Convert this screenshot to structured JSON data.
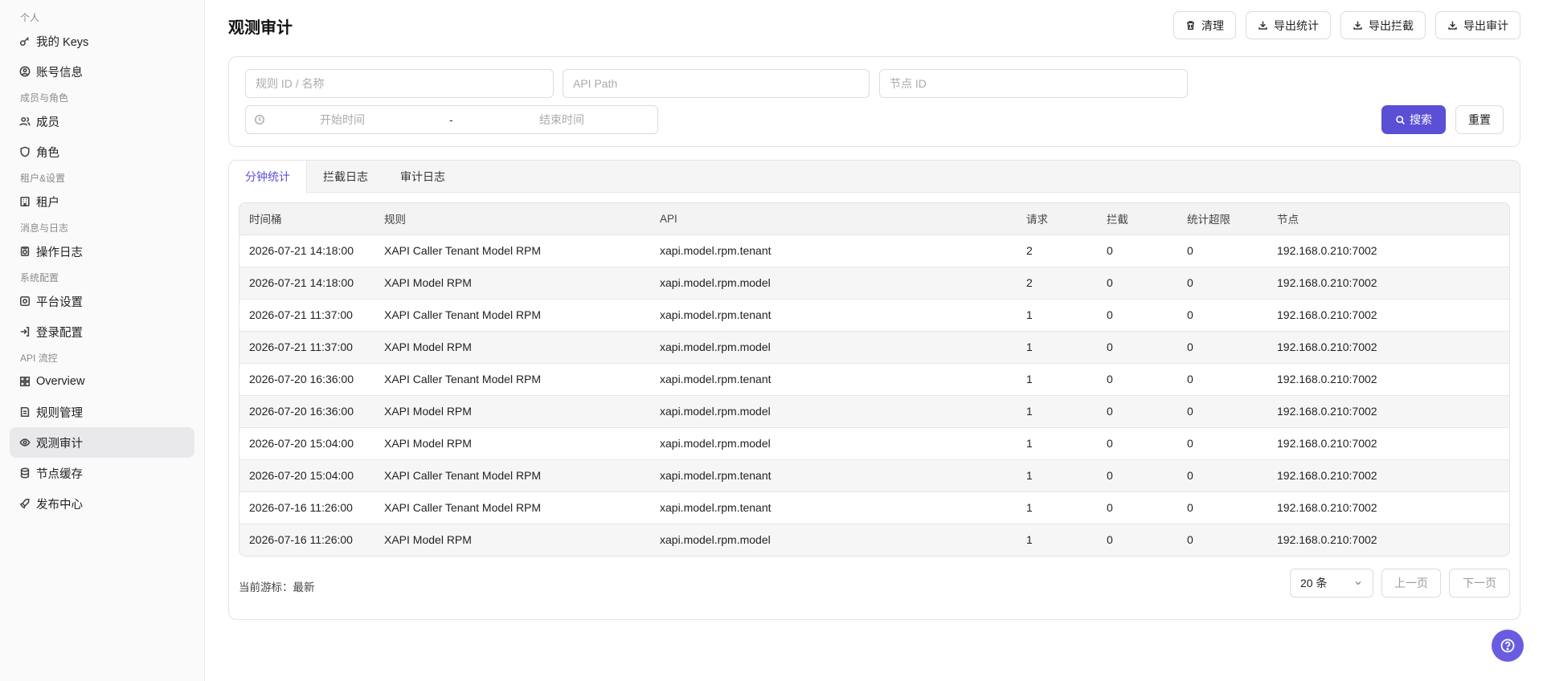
{
  "sidebar": {
    "groups": [
      {
        "label": "个人",
        "items": [
          {
            "label": "我的 Keys",
            "icon": "key-icon"
          },
          {
            "label": "账号信息",
            "icon": "user-circle-icon"
          }
        ]
      },
      {
        "label": "成员与角色",
        "items": [
          {
            "label": "成员",
            "icon": "users-icon"
          },
          {
            "label": "角色",
            "icon": "shield-icon"
          }
        ]
      },
      {
        "label": "租户&设置",
        "items": [
          {
            "label": "租户",
            "icon": "building-icon"
          }
        ]
      },
      {
        "label": "消息与日志",
        "items": [
          {
            "label": "操作日志",
            "icon": "log-icon"
          }
        ]
      },
      {
        "label": "系统配置",
        "items": [
          {
            "label": "平台设置",
            "icon": "settings-icon"
          },
          {
            "label": "登录配置",
            "icon": "login-icon"
          }
        ]
      },
      {
        "label": "API 流控",
        "items": [
          {
            "label": "Overview",
            "icon": "grid-icon"
          },
          {
            "label": "规则管理",
            "icon": "rules-icon"
          },
          {
            "label": "观测审计",
            "icon": "audit-icon"
          },
          {
            "label": "节点缓存",
            "icon": "database-icon"
          },
          {
            "label": "发布中心",
            "icon": "rocket-icon"
          }
        ]
      }
    ],
    "active": "观测审计"
  },
  "header": {
    "title": "观测审计",
    "buttons": {
      "clear": "清理",
      "export_stats": "导出统计",
      "export_block": "导出拦截",
      "export_audit": "导出审计"
    }
  },
  "filters": {
    "rule_placeholder": "规则 ID / 名称",
    "api_placeholder": "API Path",
    "node_placeholder": "节点 ID",
    "start_placeholder": "开始时间",
    "range_sep": "-",
    "end_placeholder": "结束时间",
    "search_label": "搜索",
    "reset_label": "重置"
  },
  "tabs": {
    "minute_stats": "分钟统计",
    "block_log": "拦截日志",
    "audit_log": "审计日志",
    "active": "分钟统计"
  },
  "table": {
    "columns": {
      "bucket": "时间桶",
      "rule": "规则",
      "api": "API",
      "requests": "请求",
      "blocked": "拦截",
      "over": "统计超限",
      "node": "节点"
    },
    "rows": [
      {
        "bucket": "2026-07-21 14:18:00",
        "rule": "XAPI Caller Tenant Model RPM",
        "api": "xapi.model.rpm.tenant",
        "requests": "2",
        "blocked": "0",
        "over": "0",
        "node": "192.168.0.210:7002"
      },
      {
        "bucket": "2026-07-21 14:18:00",
        "rule": "XAPI Model RPM",
        "api": "xapi.model.rpm.model",
        "requests": "2",
        "blocked": "0",
        "over": "0",
        "node": "192.168.0.210:7002"
      },
      {
        "bucket": "2026-07-21 11:37:00",
        "rule": "XAPI Caller Tenant Model RPM",
        "api": "xapi.model.rpm.tenant",
        "requests": "1",
        "blocked": "0",
        "over": "0",
        "node": "192.168.0.210:7002"
      },
      {
        "bucket": "2026-07-21 11:37:00",
        "rule": "XAPI Model RPM",
        "api": "xapi.model.rpm.model",
        "requests": "1",
        "blocked": "0",
        "over": "0",
        "node": "192.168.0.210:7002"
      },
      {
        "bucket": "2026-07-20 16:36:00",
        "rule": "XAPI Caller Tenant Model RPM",
        "api": "xapi.model.rpm.tenant",
        "requests": "1",
        "blocked": "0",
        "over": "0",
        "node": "192.168.0.210:7002"
      },
      {
        "bucket": "2026-07-20 16:36:00",
        "rule": "XAPI Model RPM",
        "api": "xapi.model.rpm.model",
        "requests": "1",
        "blocked": "0",
        "over": "0",
        "node": "192.168.0.210:7002"
      },
      {
        "bucket": "2026-07-20 15:04:00",
        "rule": "XAPI Model RPM",
        "api": "xapi.model.rpm.model",
        "requests": "1",
        "blocked": "0",
        "over": "0",
        "node": "192.168.0.210:7002"
      },
      {
        "bucket": "2026-07-20 15:04:00",
        "rule": "XAPI Caller Tenant Model RPM",
        "api": "xapi.model.rpm.tenant",
        "requests": "1",
        "blocked": "0",
        "over": "0",
        "node": "192.168.0.210:7002"
      },
      {
        "bucket": "2026-07-16 11:26:00",
        "rule": "XAPI Caller Tenant Model RPM",
        "api": "xapi.model.rpm.tenant",
        "requests": "1",
        "blocked": "0",
        "over": "0",
        "node": "192.168.0.210:7002"
      },
      {
        "bucket": "2026-07-16 11:26:00",
        "rule": "XAPI Model RPM",
        "api": "xapi.model.rpm.model",
        "requests": "1",
        "blocked": "0",
        "over": "0",
        "node": "192.168.0.210:7002"
      }
    ]
  },
  "pagination": {
    "cursor_text": "当前游标：最新",
    "page_size": "20 条",
    "prev": "上一页",
    "next": "下一页"
  },
  "colors": {
    "accent": "#5b4fd6",
    "help": "#6a5ce0"
  }
}
